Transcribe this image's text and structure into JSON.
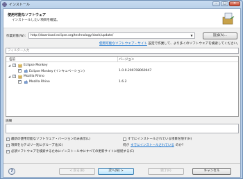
{
  "window": {
    "title": "インストール"
  },
  "header": {
    "title": "使用可能なソフトウェア",
    "subtitle": "インストールしたい項目を確認。"
  },
  "work_with": {
    "label": "作業対象(W):",
    "value": "http://download.eclipse.org/technology/dash/update/",
    "add_button": "追加(A)...",
    "settings_link": "使用可能なソフトウェア・サイト",
    "settings_suffix": " 設定で作業して、より多くのソフトウェアを検索してください。"
  },
  "filter": {
    "placeholder": "フィルター入力"
  },
  "table": {
    "columns": [
      "名前",
      "バージョン"
    ],
    "rows": [
      {
        "level": 0,
        "expanded": true,
        "checked": true,
        "name": "Eclipse Monkey",
        "version": ""
      },
      {
        "level": 1,
        "expanded": false,
        "checked": true,
        "name": "Eclipse Monkey (インキュベーション)",
        "version": "1.0.0.200708060947"
      },
      {
        "level": 0,
        "expanded": true,
        "checked": true,
        "name": "Mozilla Rhino",
        "version": ""
      },
      {
        "level": 1,
        "expanded": false,
        "checked": true,
        "name": "Mozilla Rhino",
        "version": "1.6.2"
      }
    ]
  },
  "details": {
    "label": "詳細"
  },
  "options": {
    "latest_only": "最新の使用可能なソフトウェア・バージョンのみ表示(L)",
    "group_by_category": "項目をカテゴリー別にグループ化(G)",
    "contact_all_sites": "必須ソフトウェアを検索するためにインストール中にすべての更新サイトに接続する(C)",
    "hide_installed": "すでにインストールされている項目を隠す(H)",
    "already_installed_prefix": "何が",
    "already_installed_link": "すでにインストールされている",
    "already_installed_suffix": "のか?"
  },
  "buttons": {
    "back": "< 戻る(B)",
    "next": "次へ(N) >",
    "finish": "完了(F)",
    "cancel": "キャンセル"
  },
  "colors": {
    "link": "#0066cc",
    "frame": "#b9d0ea"
  }
}
